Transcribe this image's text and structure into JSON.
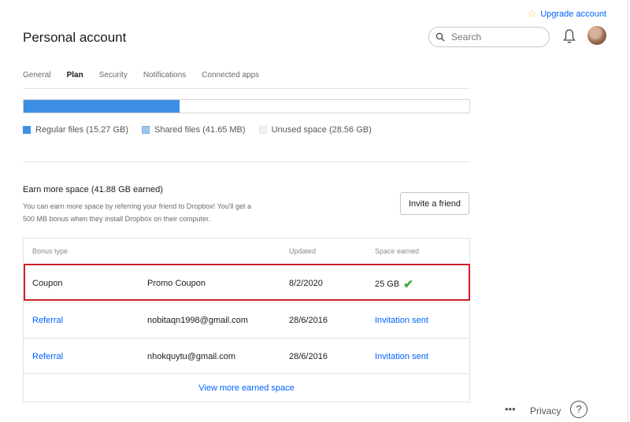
{
  "header": {
    "upgrade_label": "Upgrade account",
    "title": "Personal account",
    "search_placeholder": "Search"
  },
  "tabs": [
    {
      "label": "General"
    },
    {
      "label": "Plan",
      "active": true
    },
    {
      "label": "Security"
    },
    {
      "label": "Notifications"
    },
    {
      "label": "Connected apps"
    }
  ],
  "storage": {
    "regular_fraction": 0.35,
    "legend": {
      "regular": "Regular files (15.27 GB)",
      "shared": "Shared files (41.65 MB)",
      "unused": "Unused space (28.56 GB)"
    }
  },
  "earn": {
    "title": "Earn more space (41.88 GB earned)",
    "description": "You can earn more space by referring your friend to Dropbox! You'll get a 500 MB bonus when they install Dropbox on their computer.",
    "invite_label": "Invite a friend"
  },
  "table": {
    "headers": {
      "type": "Bonus type",
      "updated": "Updated",
      "space": "Space earned"
    },
    "rows": [
      {
        "type": "Coupon",
        "detail": "Promo Coupon",
        "updated": "8/2/2020",
        "space": "25 GB",
        "check_icon": "check-icon"
      },
      {
        "type": "Referral",
        "detail": "nobitaqn1998@gmail.com",
        "updated": "28/6/2016",
        "space": "Invitation sent"
      },
      {
        "type": "Referral",
        "detail": "nhokquytu@gmail.com",
        "updated": "28/6/2016",
        "space": "Invitation sent"
      }
    ],
    "more_label": "View more earned space"
  },
  "footer": {
    "dots": "•••",
    "privacy": "Privacy",
    "help": "?"
  },
  "colors": {
    "accent": "#0061fe",
    "bar": "#3d8fe6",
    "highlight": "#d0202a",
    "check": "#3fa83f"
  }
}
